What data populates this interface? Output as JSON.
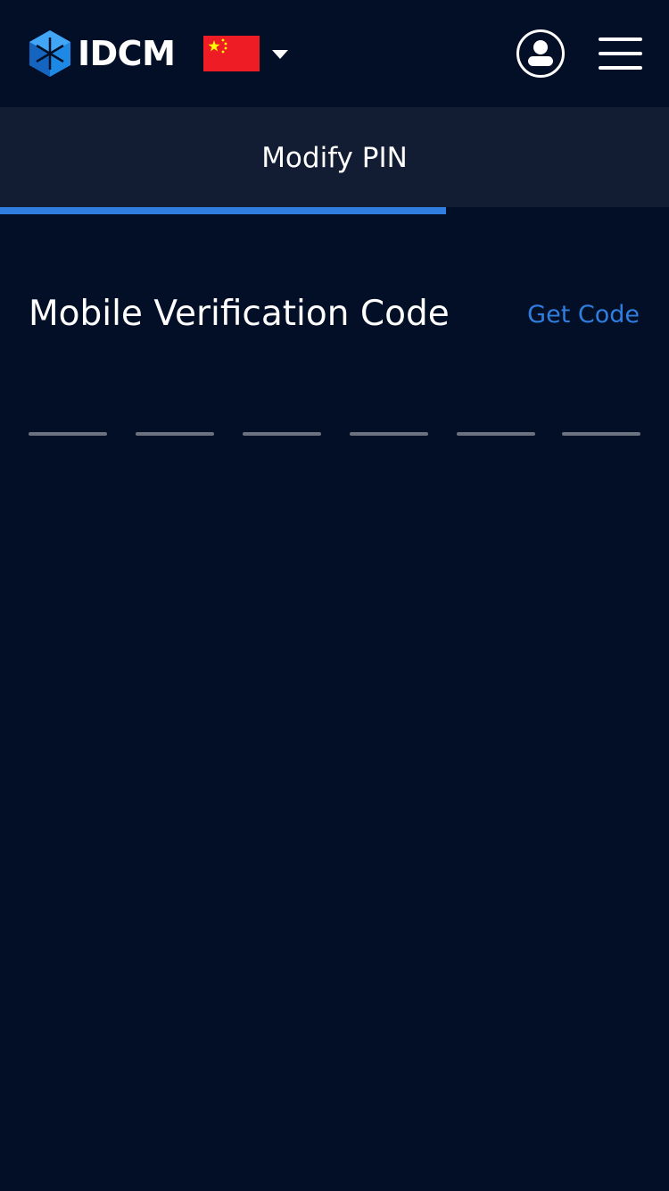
{
  "header": {
    "logo_text": "IDCM",
    "logo_icon": "idcm-cube-icon",
    "country_flag_icon": "china-flag-icon",
    "country_dropdown_icon": "caret-down-icon",
    "user_icon": "user-icon",
    "menu_icon": "hamburger-menu-icon"
  },
  "tabs": [
    {
      "label": "Modify PIN",
      "active": true
    }
  ],
  "form": {
    "field_label": "Mobile Verification Code",
    "get_code_label": "Get Code",
    "code_digits": [
      "",
      "",
      "",
      "",
      "",
      ""
    ]
  },
  "colors": {
    "background": "#020f26",
    "tab_background": "#121d33",
    "accent": "#2f7ee0",
    "slot_line": "#6b7280"
  }
}
